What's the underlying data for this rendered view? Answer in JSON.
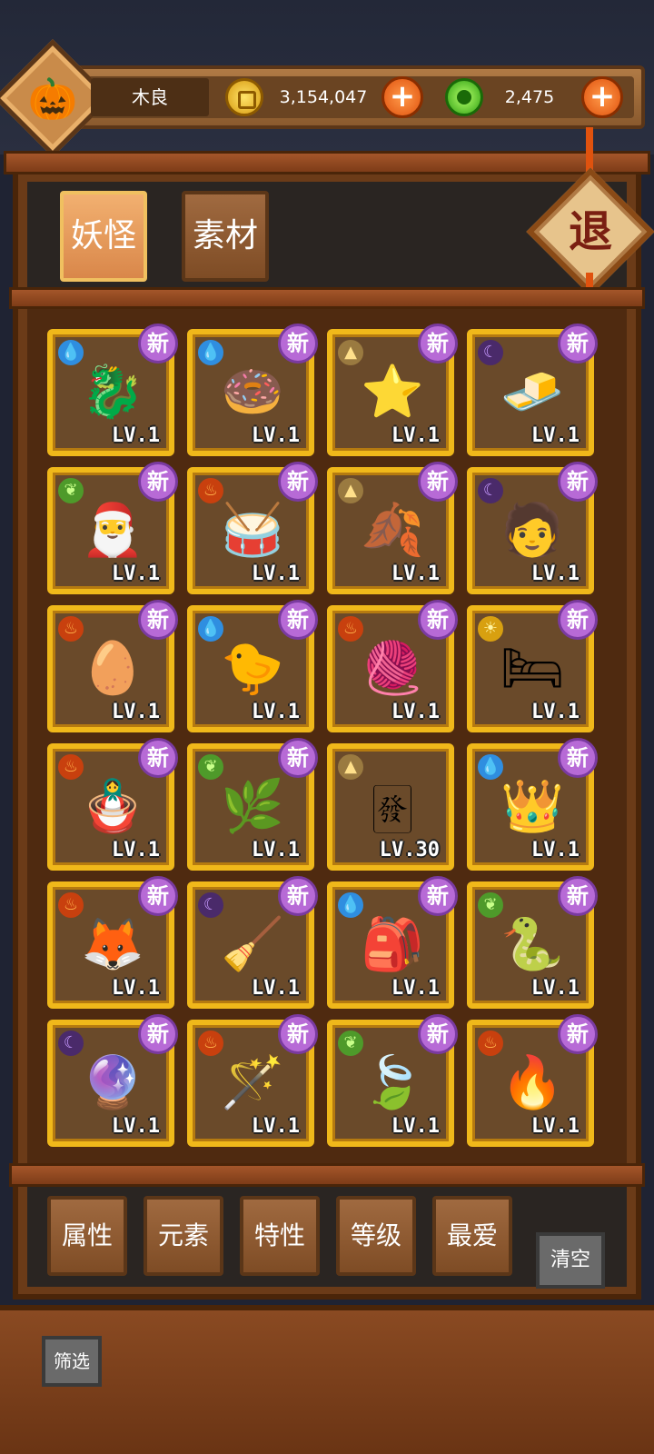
{
  "header": {
    "player_name": "木良",
    "gold": "3,154,047",
    "jade": "2,475",
    "plus_label": "+"
  },
  "tabs": {
    "monsters": "妖怪",
    "materials": "素材"
  },
  "exit_label": "退",
  "cards": [
    {
      "element": "water",
      "art": "🐉",
      "level": "LV.1",
      "badge": "新"
    },
    {
      "element": "water",
      "art": "🍩",
      "level": "LV.1",
      "badge": "新"
    },
    {
      "element": "earth",
      "art": "⭐",
      "level": "LV.1",
      "badge": "新"
    },
    {
      "element": "moon",
      "art": "🧈",
      "level": "LV.1",
      "badge": "新"
    },
    {
      "element": "grass",
      "art": "🎅",
      "level": "LV.1",
      "badge": "新"
    },
    {
      "element": "fire",
      "art": "🥁",
      "level": "LV.1",
      "badge": "新"
    },
    {
      "element": "earth",
      "art": "🍂",
      "level": "LV.1",
      "badge": "新"
    },
    {
      "element": "moon",
      "art": "🧑",
      "level": "LV.1",
      "badge": "新"
    },
    {
      "element": "fire",
      "art": "🥚",
      "level": "LV.1",
      "badge": "新"
    },
    {
      "element": "water",
      "art": "🐤",
      "level": "LV.1",
      "badge": "新"
    },
    {
      "element": "fire",
      "art": "🧶",
      "level": "LV.1",
      "badge": "新"
    },
    {
      "element": "sun",
      "art": "🛏",
      "level": "LV.1",
      "badge": "新"
    },
    {
      "element": "fire",
      "art": "🪆",
      "level": "LV.1",
      "badge": "新"
    },
    {
      "element": "grass",
      "art": "🌿",
      "level": "LV.1",
      "badge": "新"
    },
    {
      "element": "earth",
      "art": "🀅",
      "level": "LV.30",
      "badge": ""
    },
    {
      "element": "water",
      "art": "👑",
      "level": "LV.1",
      "badge": "新"
    },
    {
      "element": "fire",
      "art": "🦊",
      "level": "LV.1",
      "badge": "新"
    },
    {
      "element": "moon",
      "art": "🧹",
      "level": "LV.1",
      "badge": "新"
    },
    {
      "element": "water",
      "art": "🎒",
      "level": "LV.1",
      "badge": "新"
    },
    {
      "element": "grass",
      "art": "🐍",
      "level": "LV.1",
      "badge": "新"
    },
    {
      "element": "moon",
      "art": "🔮",
      "level": "LV.1",
      "badge": "新"
    },
    {
      "element": "fire",
      "art": "🪄",
      "level": "LV.1",
      "badge": "新"
    },
    {
      "element": "grass",
      "art": "🍃",
      "level": "LV.1",
      "badge": "新"
    },
    {
      "element": "fire",
      "art": "🔥",
      "level": "LV.1",
      "badge": "新"
    }
  ],
  "filters": {
    "attribute": "属性",
    "element": "元素",
    "trait": "特性",
    "level": "等级",
    "favorite": "最爱",
    "clear": "清空",
    "screen": "筛选"
  },
  "colors": {
    "card_border": "#f0b81a",
    "new_badge": "#b76ad6",
    "accent_orange": "#e0520e"
  }
}
